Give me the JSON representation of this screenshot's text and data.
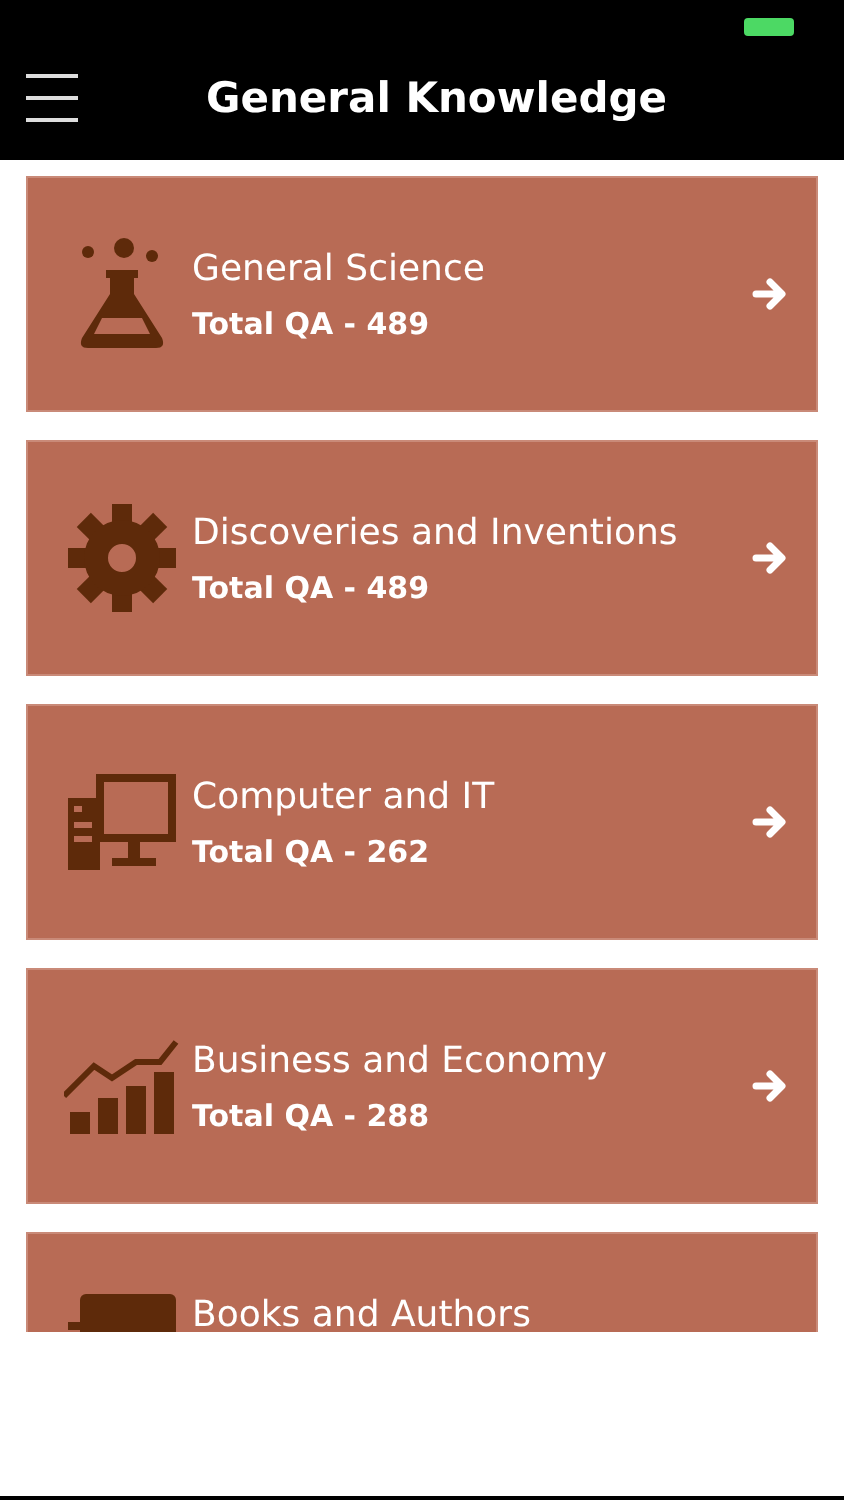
{
  "header": {
    "title": "General Knowledge"
  },
  "categories": [
    {
      "kind": "science",
      "title": "General Science",
      "subtitle": "Total QA - 489"
    },
    {
      "kind": "inventions",
      "title": "Discoveries and Inventions",
      "subtitle": "Total QA - 489"
    },
    {
      "kind": "computer",
      "title": "Computer and IT",
      "subtitle": "Total QA - 262"
    },
    {
      "kind": "business",
      "title": "Business and Economy",
      "subtitle": "Total QA - 288"
    },
    {
      "kind": "books",
      "title": "Books and Authors"
    }
  ]
}
